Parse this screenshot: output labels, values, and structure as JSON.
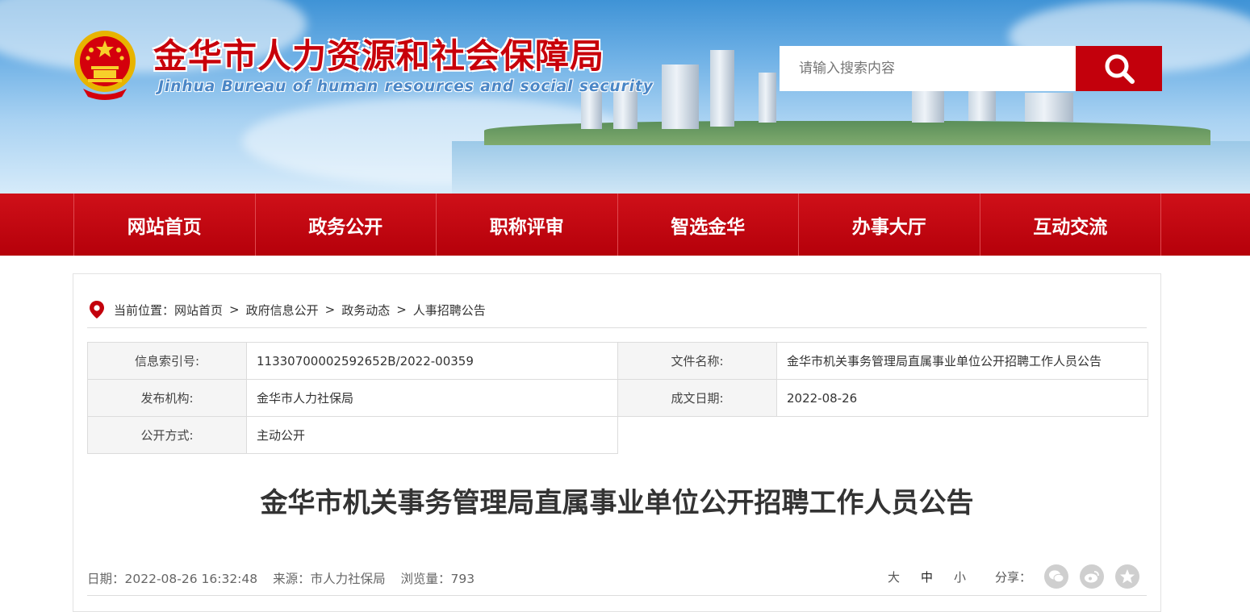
{
  "header": {
    "title": "金华市人力资源和社会保障局",
    "subtitle": "Jinhua Bureau of human resources and social security",
    "search_placeholder": "请输入搜索内容",
    "emblem": "national-emblem-icon",
    "search_icon": "search-icon"
  },
  "nav": {
    "items": [
      "网站首页",
      "政务公开",
      "职称评审",
      "智选金华",
      "办事大厅",
      "互动交流"
    ]
  },
  "breadcrumb": {
    "label": "当前位置：",
    "icon": "location-pin-icon",
    "items": [
      "网站首页",
      "政府信息公开",
      "政务动态",
      "人事招聘公告"
    ],
    "separator": ">"
  },
  "meta": {
    "index_label": "信息索引号:",
    "index_value": "11330700002592652B/2022-00359",
    "filename_label": "文件名称:",
    "filename_value": "金华市机关事务管理局直属事业单位公开招聘工作人员公告",
    "publisher_label": "发布机构:",
    "publisher_value": "金华市人力社保局",
    "date_label": "成文日期:",
    "date_value": "2022-08-26",
    "mode_label": "公开方式:",
    "mode_value": "主动公开"
  },
  "article": {
    "title": "金华市机关事务管理局直属事业单位公开招聘工作人员公告",
    "date": "日期：2022-08-26 16:32:48",
    "source": "来源：市人力社保局",
    "views": "浏览量：793"
  },
  "tools": {
    "font_large": "大",
    "font_medium": "中",
    "font_small": "小",
    "share_label": "分享：",
    "share_icons": [
      "wechat-icon",
      "weibo-icon",
      "qzone-icon"
    ]
  },
  "colors": {
    "brand_red": "#c3000c",
    "nav_red": "#c40810"
  }
}
